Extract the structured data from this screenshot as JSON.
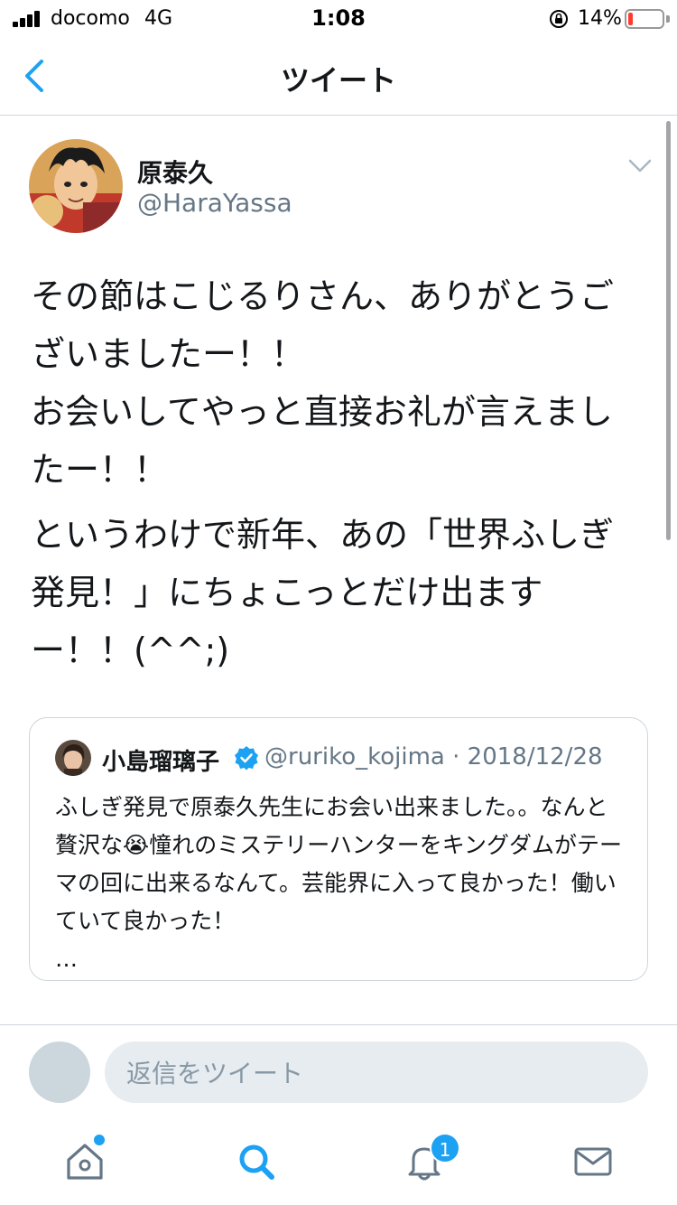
{
  "status_bar": {
    "carrier": "docomo",
    "network": "4G",
    "time": "1:08",
    "battery_percent": "14%",
    "battery_level": 0.14
  },
  "nav": {
    "title": "ツイート",
    "back_icon": "chevron-left-icon"
  },
  "tweet": {
    "display_name": "原泰久",
    "handle": "@HaraYassa",
    "paragraphs": [
      "その節はこじるりさん、ありがとうございましたー！！\nお会いしてやっと直接お礼が言えましたー！！",
      "というわけで新年、あの「世界ふしぎ発見！」にちょこっとだけ出ますー！！(^^;)"
    ]
  },
  "quote_tweet": {
    "display_name": "小島瑠璃子",
    "handle": "@ruriko_kojima",
    "date": "2018/12/28",
    "text_before_emoji": "ふしぎ発見で原泰久先生にお会い出来ました。。なんと贅沢な",
    "emoji": "😭",
    "text_after_emoji": "憧れのミステリーハンターをキングダムがテーマの回に出来るなんて。芸能界に入って良かった！働いていて良かった！",
    "ellipsis": "…"
  },
  "reply": {
    "placeholder": "返信をツイート"
  },
  "tabs": {
    "notifications_badge": "1"
  },
  "colors": {
    "accent": "#1da1f2",
    "text": "#14171a",
    "secondary_text": "#657786",
    "border": "#ccd6dd"
  }
}
